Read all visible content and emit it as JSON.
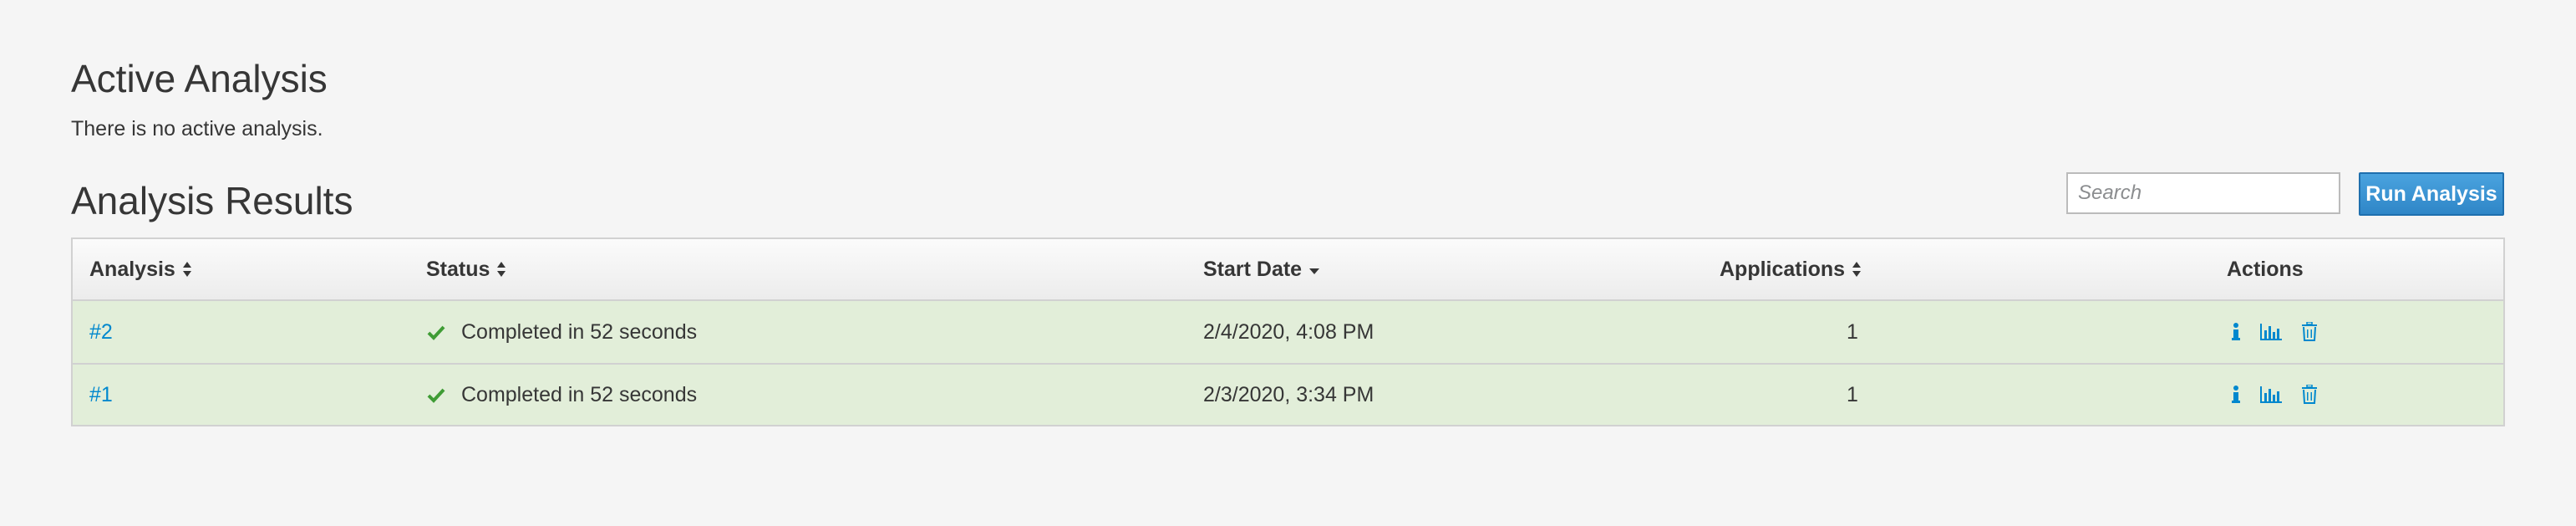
{
  "active": {
    "title": "Active Analysis",
    "message": "There is no active analysis."
  },
  "results": {
    "title": "Analysis Results",
    "search_placeholder": "Search",
    "run_button_label": "Run Analysis"
  },
  "table": {
    "columns": [
      {
        "label": "Analysis",
        "sort": "both"
      },
      {
        "label": "Status",
        "sort": "both"
      },
      {
        "label": "Start Date",
        "sort": "desc"
      },
      {
        "label": "Applications",
        "sort": "both"
      },
      {
        "label": "Actions",
        "sort": "none"
      }
    ],
    "rows": [
      {
        "analysis": "#2",
        "status": "Completed in 52 seconds",
        "start_date": "2/4/2020, 4:08 PM",
        "applications": "1"
      },
      {
        "analysis": "#1",
        "status": "Completed in 52 seconds",
        "start_date": "2/3/2020, 3:34 PM",
        "applications": "1"
      }
    ],
    "row_actions": [
      "info-icon",
      "bar-chart-icon",
      "trash-icon"
    ]
  },
  "colors": {
    "accent": "#0088ce",
    "button": "#2f86c7",
    "success": "#3f9c35",
    "row_success_bg": "#e2eed9"
  }
}
